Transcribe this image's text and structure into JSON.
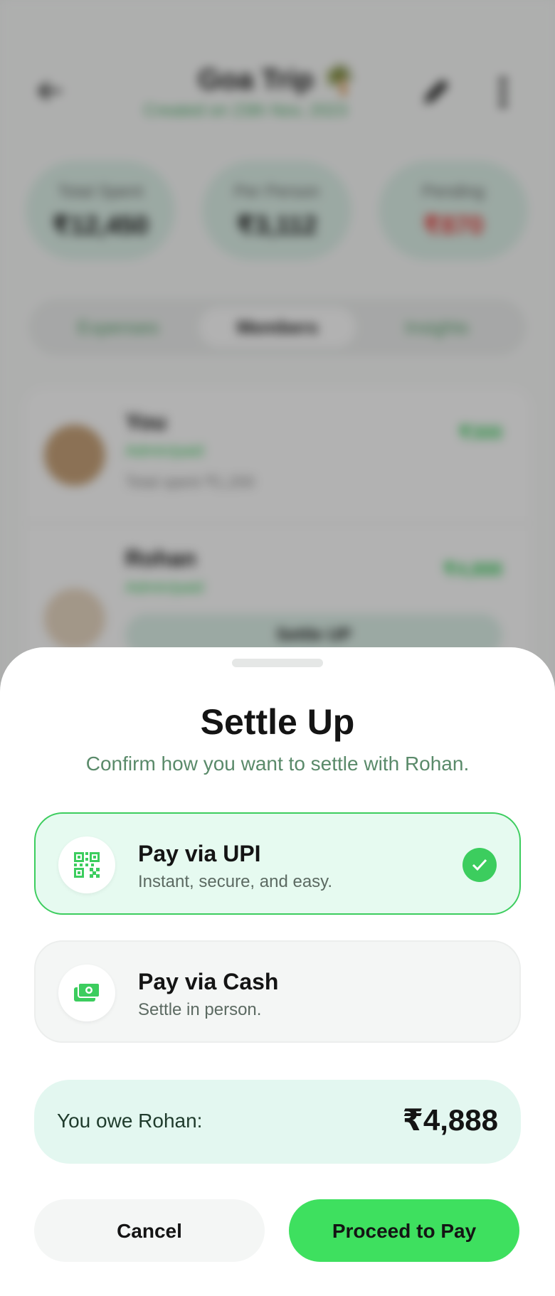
{
  "background": {
    "trip_title": "Goa Trip 🌴",
    "trip_subtitle": "Created on 23th Nov, 2023",
    "stats": [
      {
        "label": "Total Spent",
        "value": "₹12,450"
      },
      {
        "label": "Per Person",
        "value": "₹3,112"
      },
      {
        "label": "Pending",
        "value": "₹870"
      }
    ],
    "tabs": [
      "Expenses",
      "Members",
      "Insights"
    ],
    "active_tab": "Members",
    "members": [
      {
        "name": "You",
        "role": "Admin/paid",
        "total": "Total spent ₹1,200",
        "amount": "₹300"
      },
      {
        "name": "Rohan",
        "role": "Admin/paid",
        "amount": "₹4,888",
        "settle_label": "Settle UP"
      }
    ]
  },
  "sheet": {
    "title": "Settle Up",
    "subtitle": "Confirm how you want to settle with Rohan.",
    "options": [
      {
        "title": "Pay via UPI",
        "description": "Instant, secure, and easy.",
        "icon": "qr-code-icon",
        "selected": true
      },
      {
        "title": "Pay via Cash",
        "description": "Settle in person.",
        "icon": "cash-icon",
        "selected": false
      }
    ],
    "owe_label": "You owe Rohan:",
    "owe_amount": "₹4,888",
    "cancel_label": "Cancel",
    "proceed_label": "Proceed to Pay"
  },
  "colors": {
    "accent": "#3ee05f",
    "selected_bg": "#e6faf0",
    "owe_bg": "#e3f7f0",
    "subtitle": "#5a8a6a"
  }
}
